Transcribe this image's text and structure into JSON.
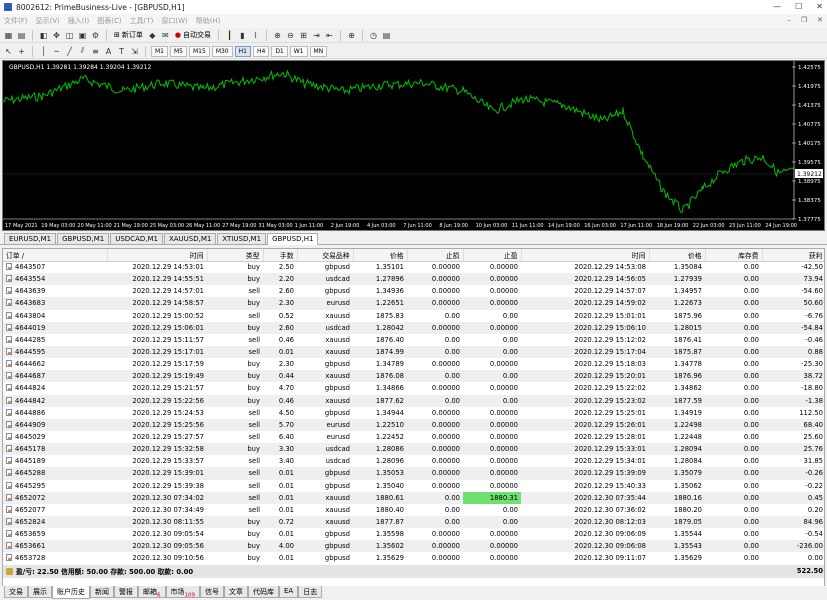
{
  "window": {
    "title": "8002612: PrimeBusiness-Live - [GBPUSD,H1]",
    "controls": [
      "—",
      "☐",
      "✕"
    ]
  },
  "menu": [
    "文件(F)",
    "显示(V)",
    "插入(I)",
    "图表(C)",
    "工具(T)",
    "窗口(W)",
    "帮助(H)"
  ],
  "mdi_controls": [
    "–",
    "❐",
    "✕"
  ],
  "toolbar": {
    "new_order": "新订单",
    "autotrade": "自动交易",
    "timeframes": [
      "M1",
      "M5",
      "M15",
      "M30",
      "H1",
      "H4",
      "D1",
      "W1",
      "MN"
    ],
    "active_timeframe": "H1"
  },
  "chart": {
    "symbol_label": "GBPUSD,H1  1.39281 1.39284 1.39204 1.39212",
    "line_color": "#00c000",
    "price_ticks": [
      "1.42575",
      "1.41975",
      "1.41375",
      "1.40775",
      "1.40175",
      "1.39575",
      "1.38975",
      "1.38375",
      "1.37775"
    ],
    "current_price": "1.39212",
    "time_ticks": [
      "17 May 2021",
      "19 May 03:00",
      "20 May 11:00",
      "21 May 19:00",
      "25 May 03:00",
      "26 May 11:00",
      "27 May 19:00",
      "31 May 03:00",
      "1 Jun 11:00",
      "2 Jun 19:00",
      "4 Jun 03:00",
      "7 Jun 11:00",
      "8 Jun 19:00",
      "10 Jun 03:00",
      "11 Jun 11:00",
      "14 Jun 19:00",
      "16 Jun 03:00",
      "17 Jun 11:00",
      "18 Jun 19:00",
      "22 Jun 03:00",
      "23 Jun 11:00",
      "24 Jun 19:00"
    ]
  },
  "chart_tabs": [
    "EURUSD,M1",
    "GBPUSD,M1",
    "USDCAD,M1",
    "XAUUSD,M1",
    "XTIUSD,M1",
    "GBPUSD,H1"
  ],
  "active_chart_tab": "GBPUSD,H1",
  "history": {
    "columns": [
      "订单 /",
      "时间",
      "类型",
      "手数",
      "交易品种",
      "价格",
      "止损",
      "止盈",
      "时间",
      "价格",
      "库存费",
      "获利"
    ],
    "rows": [
      [
        "4643507",
        "2020.12.29 14:53:01",
        "buy",
        "2.50",
        "gbpusd",
        "1.35101",
        "0.00000",
        "0.00000",
        "2020.12.29 14:53:08",
        "1.35084",
        "0.00",
        "-42.50"
      ],
      [
        "4643554",
        "2020.12.29 14:55:51",
        "buy",
        "2.20",
        "usdcad",
        "1.27896",
        "0.00000",
        "0.00000",
        "2020.12.29 14:56:05",
        "1.27939",
        "0.00",
        "73.94"
      ],
      [
        "4643639",
        "2020.12.29 14:57:01",
        "sell",
        "2.60",
        "gbpusd",
        "1.34936",
        "0.00000",
        "0.00000",
        "2020.12.29 14:57:07",
        "1.34957",
        "0.00",
        "-54.60"
      ],
      [
        "4643683",
        "2020.12.29 14:58:57",
        "buy",
        "2.30",
        "eurusd",
        "1.22651",
        "0.00000",
        "0.00000",
        "2020.12.29 14:59:02",
        "1.22673",
        "0.00",
        "50.60"
      ],
      [
        "4643804",
        "2020.12.29 15:00:52",
        "sell",
        "0.52",
        "xauusd",
        "1875.83",
        "0.00",
        "0.00",
        "2020.12.29 15:01:01",
        "1875.96",
        "0.00",
        "-6.76"
      ],
      [
        "4644019",
        "2020.12.29 15:06:01",
        "buy",
        "2.60",
        "usdcad",
        "1.28042",
        "0.00000",
        "0.00000",
        "2020.12.29 15:06:10",
        "1.28015",
        "0.00",
        "-54.84"
      ],
      [
        "4644285",
        "2020.12.29 15:11:57",
        "sell",
        "0.46",
        "xauusd",
        "1876.40",
        "0.00",
        "0.00",
        "2020.12.29 15:12:02",
        "1876.41",
        "0.00",
        "-0.46"
      ],
      [
        "4644595",
        "2020.12.29 15:17:01",
        "sell",
        "0.01",
        "xauusd",
        "1874.99",
        "0.00",
        "0.00",
        "2020.12.29 15:17:04",
        "1875.87",
        "0.00",
        "0.88"
      ],
      [
        "4644662",
        "2020.12.29 15:17:59",
        "buy",
        "2.30",
        "gbpusd",
        "1.34789",
        "0.00000",
        "0.00000",
        "2020.12.29 15:18:03",
        "1.34778",
        "0.00",
        "-25.30"
      ],
      [
        "4644687",
        "2020.12.29 15:19:49",
        "buy",
        "0.44",
        "xauusd",
        "1876.08",
        "0.00",
        "0.00",
        "2020.12.29 15:20:01",
        "1876.96",
        "0.00",
        "38.72"
      ],
      [
        "4644824",
        "2020.12.29 15:21:57",
        "buy",
        "4.70",
        "gbpusd",
        "1.34866",
        "0.00000",
        "0.00000",
        "2020.12.29 15:22:02",
        "1.34862",
        "0.00",
        "-18.80"
      ],
      [
        "4644842",
        "2020.12.29 15:22:56",
        "buy",
        "0.46",
        "xauusd",
        "1877.62",
        "0.00",
        "0.00",
        "2020.12.29 15:23:02",
        "1877.59",
        "0.00",
        "-1.38"
      ],
      [
        "4644886",
        "2020.12.29 15:24:53",
        "sell",
        "4.50",
        "gbpusd",
        "1.34944",
        "0.00000",
        "0.00000",
        "2020.12.29 15:25:01",
        "1.34919",
        "0.00",
        "112.50"
      ],
      [
        "4644909",
        "2020.12.29 15:25:56",
        "sell",
        "5.70",
        "eurusd",
        "1.22510",
        "0.00000",
        "0.00000",
        "2020.12.29 15:26:01",
        "1.22498",
        "0.00",
        "68.40"
      ],
      [
        "4645029",
        "2020.12.29 15:27:57",
        "sell",
        "6.40",
        "eurusd",
        "1.22452",
        "0.00000",
        "0.00000",
        "2020.12.29 15:28:01",
        "1.22448",
        "0.00",
        "25.60"
      ],
      [
        "4645178",
        "2020.12.29 15:32:58",
        "buy",
        "3.30",
        "usdcad",
        "1.28086",
        "0.00000",
        "0.00000",
        "2020.12.29 15:33:01",
        "1.28094",
        "0.00",
        "25.76"
      ],
      [
        "4645189",
        "2020.12.29 15:33:57",
        "sell",
        "3.40",
        "usdcad",
        "1.28096",
        "0.00000",
        "0.00000",
        "2020.12.29 15:34:01",
        "1.28084",
        "0.00",
        "31.85"
      ],
      [
        "4645288",
        "2020.12.29 15:39:01",
        "sell",
        "0.01",
        "gbpusd",
        "1.35053",
        "0.00000",
        "0.00000",
        "2020.12.29 15:39:09",
        "1.35079",
        "0.00",
        "-0.26"
      ],
      [
        "4645295",
        "2020.12.29 15:39:38",
        "sell",
        "0.01",
        "gbpusd",
        "1.35040",
        "0.00000",
        "0.00000",
        "2020.12.29 15:40:33",
        "1.35062",
        "0.00",
        "-0.22"
      ],
      [
        "4652072",
        "2020.12.30 07:34:02",
        "sell",
        "0.01",
        "xauusd",
        "1880.61",
        "0.00",
        "1880.31",
        "2020.12.30 07:35:44",
        "1880.16",
        "0.00",
        "0.45"
      ],
      [
        "4652077",
        "2020.12.30 07:34:49",
        "sell",
        "0.01",
        "xauusd",
        "1880.40",
        "0.00",
        "0.00",
        "2020.12.30 07:36:02",
        "1880.20",
        "0.00",
        "0.20"
      ],
      [
        "4652824",
        "2020.12.30 08:11:55",
        "buy",
        "0.72",
        "xauusd",
        "1877.87",
        "0.00",
        "0.00",
        "2020.12.30 08:12:03",
        "1879.05",
        "0.00",
        "84.96"
      ],
      [
        "4653659",
        "2020.12.30 09:05:54",
        "buy",
        "0.01",
        "gbpusd",
        "1.35598",
        "0.00000",
        "0.00000",
        "2020.12.30 09:06:09",
        "1.35544",
        "0.00",
        "-0.54"
      ],
      [
        "4653661",
        "2020.12.30 09:05:56",
        "buy",
        "4.00",
        "gbpusd",
        "1.35602",
        "0.00000",
        "0.00000",
        "2020.12.30 09:06:08",
        "1.35543",
        "0.00",
        "-236.00"
      ],
      [
        "4653728",
        "2020.12.30 09:10:56",
        "buy",
        "0.01",
        "gbpusd",
        "1.35629",
        "0.00000",
        "0.00000",
        "2020.12.30 09:11:07",
        "1.35629",
        "0.00",
        "0.00"
      ]
    ],
    "tp_highlight_color": "#6fe06f",
    "summary_label": "盈/亏: 22.50  信用额: 50.00  存款: 500.00  取款: 0.00",
    "summary_profit": "522.50"
  },
  "bottom_tabs": [
    {
      "label": "交易",
      "badge": ""
    },
    {
      "label": "展示",
      "badge": ""
    },
    {
      "label": "账户历史",
      "badge": ""
    },
    {
      "label": "新闻",
      "badge": ""
    },
    {
      "label": "警报",
      "badge": ""
    },
    {
      "label": "邮箱",
      "badge": "6"
    },
    {
      "label": "市场",
      "badge": "109"
    },
    {
      "label": "信号",
      "badge": ""
    },
    {
      "label": "文章",
      "badge": ""
    },
    {
      "label": "代码库",
      "badge": ""
    },
    {
      "label": "EA",
      "badge": ""
    },
    {
      "label": "日志",
      "badge": ""
    }
  ],
  "active_bottom_tab": "账户历史"
}
